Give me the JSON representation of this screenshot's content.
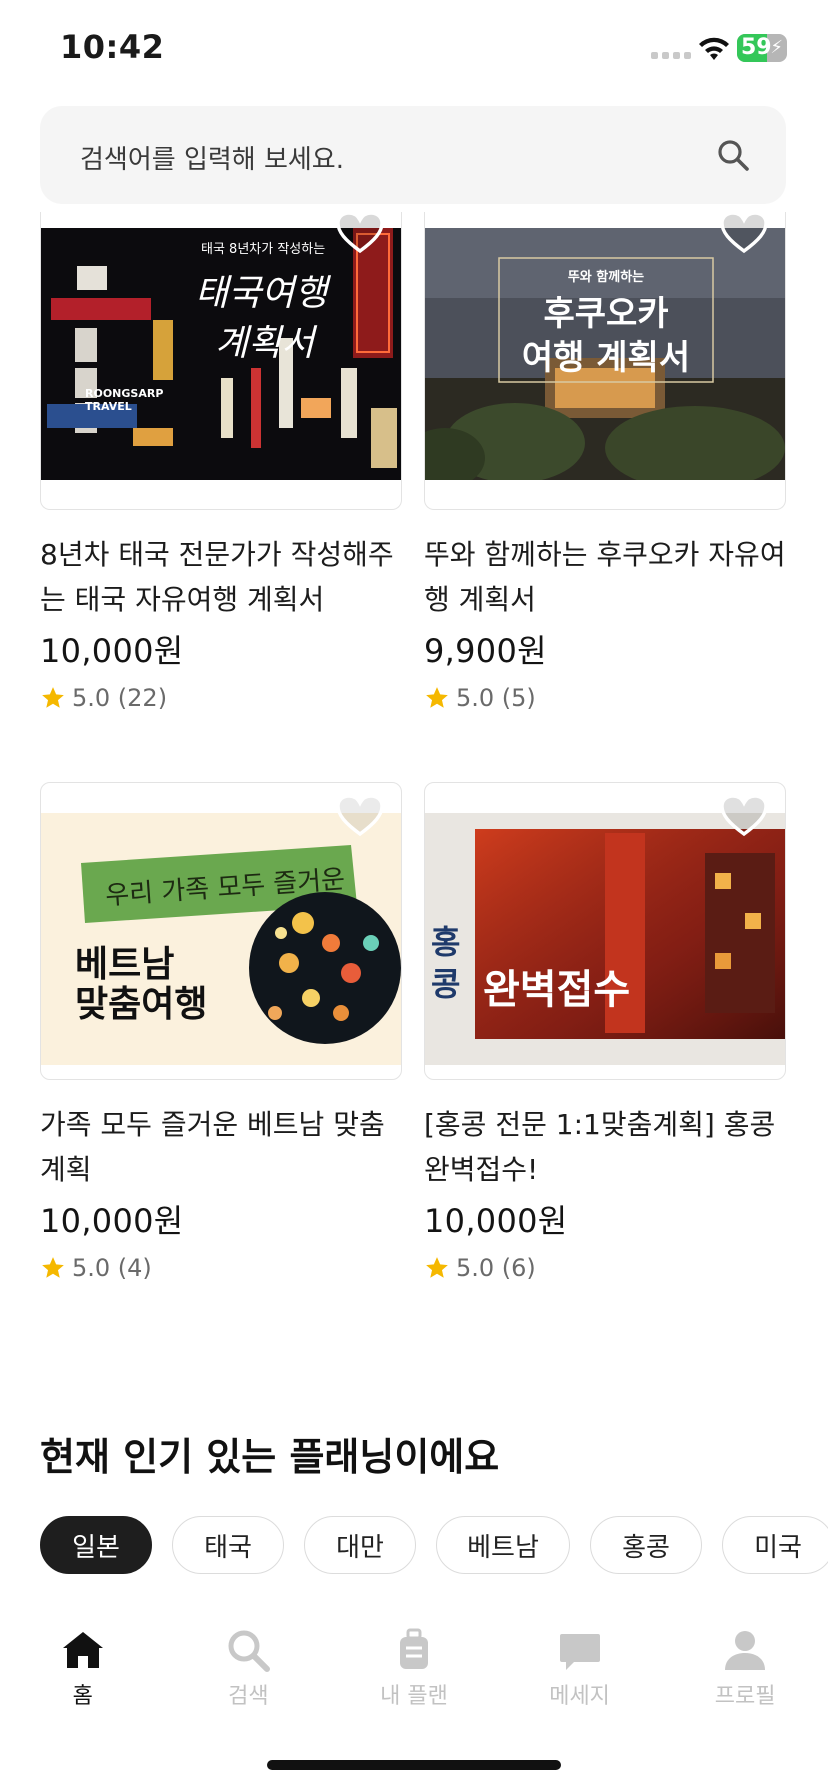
{
  "status_bar": {
    "time": "10:42",
    "battery": "59"
  },
  "search": {
    "placeholder": "검색어를 입력해 보세요."
  },
  "products": [
    {
      "image_line1": "태국 8년차가 작성하는",
      "image_line2": "태국여행",
      "image_line3": "계획서",
      "sign_text": "ROONGSARP TRAVEL",
      "title": "8년차 태국 전문가가 작성해주는 태국 자유여행 계획서",
      "price": "10,000원",
      "rating": "5.0 (22)"
    },
    {
      "image_line1": "뚜와 함께하는",
      "image_line2": "후쿠오카",
      "image_line3": "여행 계획서",
      "title": "뚜와 함께하는 후쿠오카 자유여행 계획서",
      "price": "9,900원",
      "rating": "5.0 (5)"
    },
    {
      "image_banner": "우리 가족 모두 즐거운",
      "image_line1": "베트남",
      "image_line2": "맞춤여행",
      "title": "가족 모두 즐거운 베트남 맞춤계획",
      "price": "10,000원",
      "rating": "5.0 (4)"
    },
    {
      "image_side1": "홍",
      "image_side2": "콩",
      "image_main": "완벽접수",
      "title": "[홍콩 전문 1:1맞춤계획] 홍콩 완벽접수!",
      "price": "10,000원",
      "rating": "5.0 (6)"
    }
  ],
  "popular": {
    "title": "현재 인기 있는 플래닝이에요",
    "chips": [
      "일본",
      "태국",
      "대만",
      "베트남",
      "홍콩",
      "미국"
    ]
  },
  "tabs": [
    {
      "label": "홈",
      "icon": "home-icon",
      "active": true
    },
    {
      "label": "검색",
      "icon": "search-icon",
      "active": false
    },
    {
      "label": "내 플랜",
      "icon": "luggage-icon",
      "active": false
    },
    {
      "label": "메세지",
      "icon": "message-icon",
      "active": false
    },
    {
      "label": "프로필",
      "icon": "profile-icon",
      "active": false
    }
  ],
  "colors": {
    "accent": "#1e1e1e",
    "star": "#f5b800",
    "battery": "#34c759"
  }
}
